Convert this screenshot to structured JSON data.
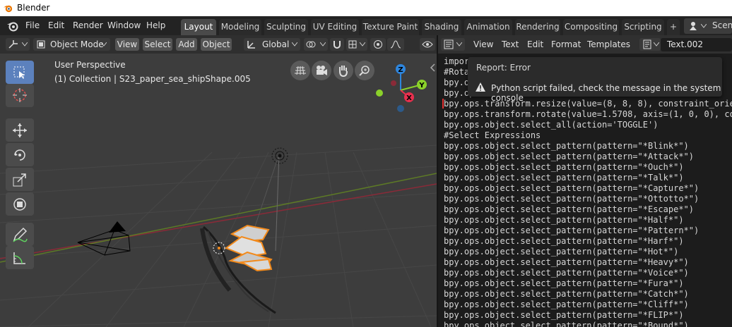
{
  "window": {
    "title": "Blender"
  },
  "menus": [
    "File",
    "Edit",
    "Render",
    "Window",
    "Help"
  ],
  "workspaces": [
    {
      "label": "Layout",
      "active": true
    },
    {
      "label": "Modeling"
    },
    {
      "label": "Sculpting"
    },
    {
      "label": "UV Editing"
    },
    {
      "label": "Texture Paint"
    },
    {
      "label": "Shading"
    },
    {
      "label": "Animation"
    },
    {
      "label": "Rendering"
    },
    {
      "label": "Compositing"
    },
    {
      "label": "Scripting"
    }
  ],
  "add_workspace": "+",
  "scene": {
    "label": "Scene"
  },
  "viewport_header": {
    "mode": "Object Mode",
    "view": "View",
    "select": "Select",
    "add": "Add",
    "object": "Object",
    "orientation": "Global"
  },
  "viewport": {
    "perspective": "User Perspective",
    "collection": "(1) Collection | S23_paper_sea_shipShape.005",
    "axes": {
      "z": "Z",
      "y": "Y",
      "x": "X"
    }
  },
  "text_editor": {
    "menus": [
      "View",
      "Text",
      "Edit",
      "Format",
      "Templates"
    ],
    "text_name": "Text.002",
    "lines": [
      "import",
      "#Rota                  Armature",
      "bpy.op",
      "bpy.op",
      "bpy.ops.transform.resize(value=(8, 8, 8), constraint_orient",
      "bpy.ops.transform.rotate(value=1.5708, axis=(1, 0, 0), cons",
      "bpy.ops.object.select_all(action='TOGGLE')",
      "#Select Expressions",
      "bpy.ops.object.select_pattern(pattern=\"*Blink*\")",
      "bpy.ops.object.select_pattern(pattern=\"*Attack*\")",
      "bpy.ops.object.select_pattern(pattern=\"*Ouch*\")",
      "bpy.ops.object.select_pattern(pattern=\"*Talk*\")",
      "bpy.ops.object.select_pattern(pattern=\"*Capture*\")",
      "bpy.ops.object.select_pattern(pattern=\"*Ottotto*\")",
      "bpy.ops.object.select_pattern(pattern=\"*Escape*\")",
      "bpy.ops.object.select_pattern(pattern=\"*Half*\")",
      "bpy.ops.object.select_pattern(pattern=\"*Pattern*\")",
      "bpy.ops.object.select_pattern(pattern=\"*Harf*\")",
      "bpy.ops.object.select_pattern(pattern=\"*Hot*\")",
      "bpy.ops.object.select_pattern(pattern=\"*Heavy*\")",
      "bpy.ops.object.select_pattern(pattern=\"*Voice*\")",
      "bpy.ops.object.select_pattern(pattern=\"*Fura*\")",
      "bpy.ops.object.select_pattern(pattern=\"*Catch*\")",
      "bpy.ops.object.select_pattern(pattern=\"*Cliff*\")",
      "bpy.ops.object.select_pattern(pattern=\"*FLIP*\")",
      "bpy.ops.object.select_pattern(pattern=\"*Bound*\")"
    ]
  },
  "report": {
    "title": "Report: Error",
    "message": "Python script failed, check the message in the system console"
  },
  "colors": {
    "accent": "#5c81bd",
    "selection_orange": "#f28a1c",
    "axis_x": "#e8304e",
    "axis_y": "#8bd12a",
    "axis_z": "#2e86de"
  }
}
